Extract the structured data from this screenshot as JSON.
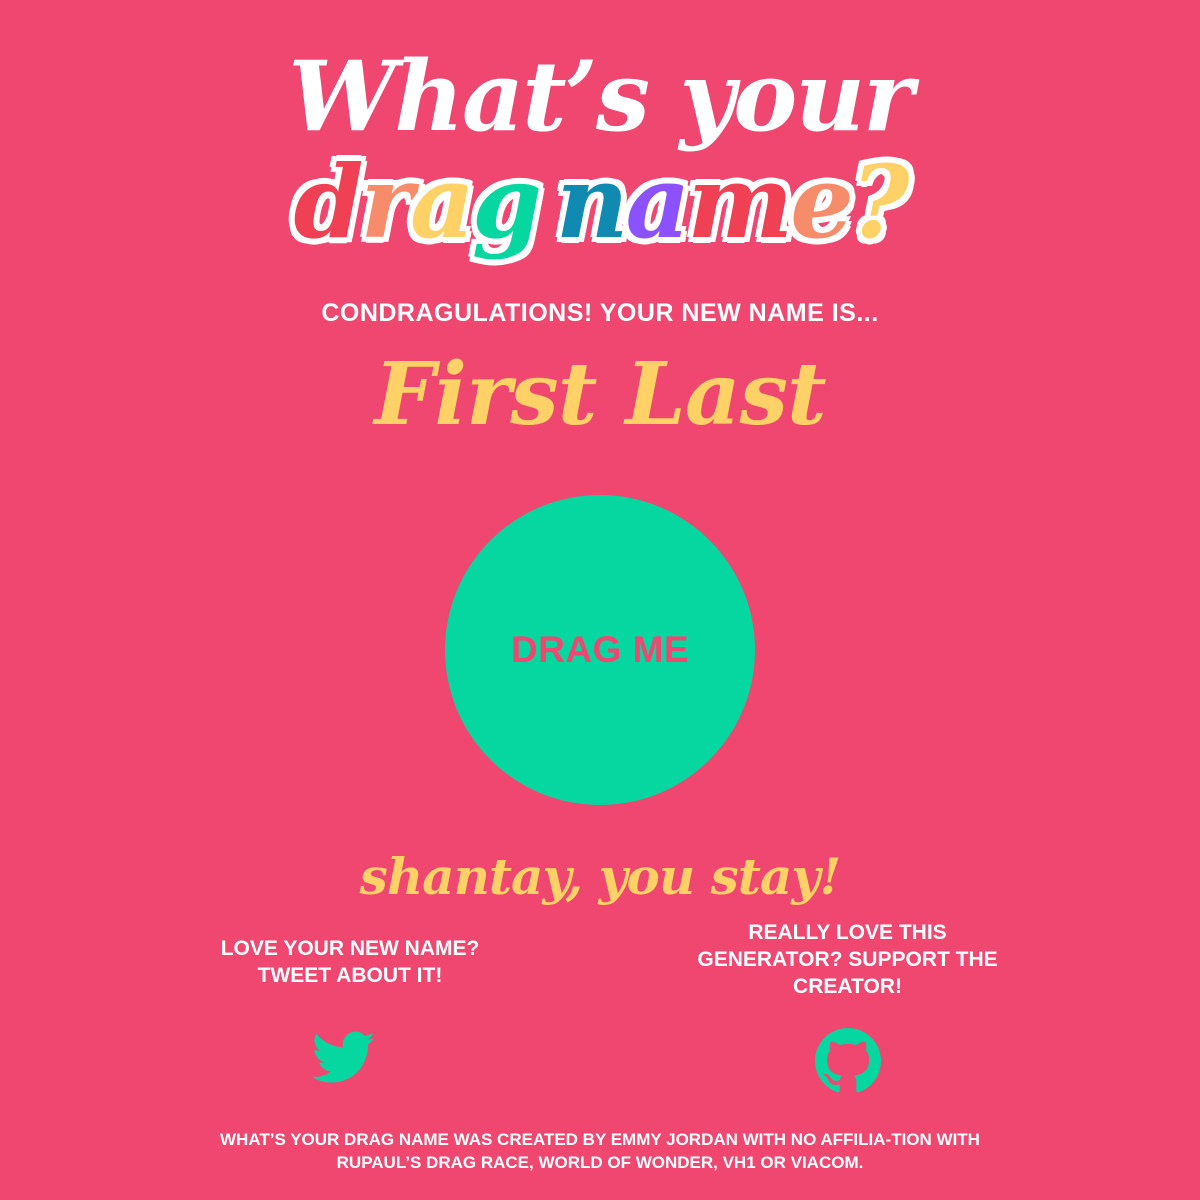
{
  "logo": {
    "line1": "What’s your",
    "line2_letters": [
      {
        "char": "d",
        "color": "#ef4054"
      },
      {
        "char": "r",
        "color": "#f78c6b"
      },
      {
        "char": "a",
        "color": "#ffd166"
      },
      {
        "char": "g",
        "color": "#06d6a0"
      },
      {
        "char": " ",
        "color": "#ffffff"
      },
      {
        "char": "n",
        "color": "#118ab2"
      },
      {
        "char": "a",
        "color": "#8c52ff"
      },
      {
        "char": "m",
        "color": "#ef4054"
      },
      {
        "char": "e",
        "color": "#f78c6b"
      },
      {
        "char": "?",
        "color": "#ffd166"
      }
    ]
  },
  "result": {
    "intro": "CONDRAGULATIONS! YOUR NEW NAME IS...",
    "name": "First Last"
  },
  "drag_button": {
    "label": "DRAG ME"
  },
  "tagline": "shantay, you stay!",
  "share": {
    "tweet_text": "LOVE YOUR NEW NAME? TWEET ABOUT IT!",
    "support_text": "REALLY LOVE THIS GENERATOR? SUPPORT THE CREATOR!",
    "tweet_icon": "twitter-icon",
    "support_icon": "github-icon"
  },
  "footer": {
    "text": "WHAT’S YOUR DRAG NAME WAS CREATED BY EMMY JORDAN WITH NO AFFILIA-TION WITH RUPAUL’S DRAG RACE, WORLD OF WONDER, VH1 OR VIACOM."
  },
  "colors": {
    "background": "#ef4770",
    "accent_green": "#06d6a0",
    "accent_yellow": "#ffd166",
    "text_white": "#ffffff"
  }
}
